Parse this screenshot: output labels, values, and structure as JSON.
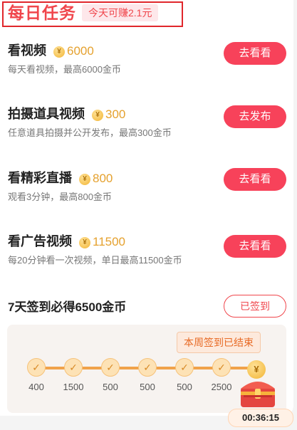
{
  "header": {
    "title": "每日任务",
    "earn_badge": "今天可赚2.1元"
  },
  "tasks": [
    {
      "name": "看视频",
      "reward": "6000",
      "desc": "每天看视频，最高6000金币",
      "button": "去看看"
    },
    {
      "name": "拍摄道具视频",
      "reward": "300",
      "desc": "任意道具拍摄并公开发布，最高300金币",
      "button": "去发布"
    },
    {
      "name": "看精彩直播",
      "reward": "800",
      "desc": "观看3分钟，最高800金币",
      "button": "去看看"
    },
    {
      "name": "看广告视频",
      "reward": "11500",
      "desc": "每20分钟看一次视频，单日最高11500金币",
      "button": "去看看"
    }
  ],
  "signin": {
    "title": "7天签到必得6500金币",
    "button": "已签到",
    "week_status": "本周签到已结束",
    "days": [
      "400",
      "1500",
      "500",
      "500",
      "500",
      "2500"
    ],
    "timer": "00:36:15",
    "coin_symbol": "¥",
    "check_symbol": "✓"
  },
  "colors": {
    "accent": "#f7425a",
    "title_red": "#f0464c",
    "gold": "#e5a12e"
  }
}
